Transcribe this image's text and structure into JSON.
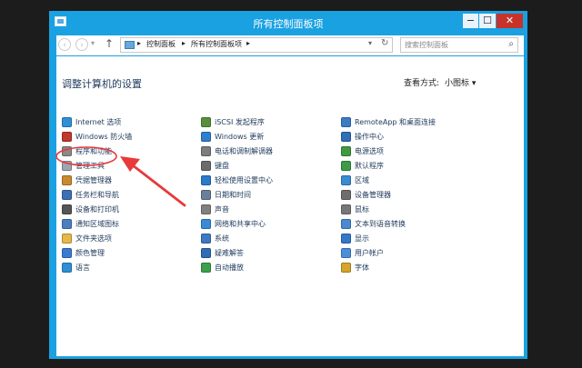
{
  "window": {
    "title": "所有控制面板项",
    "controls": {
      "minimize": "−",
      "maximize": "☐",
      "close": "✕"
    }
  },
  "navigation": {
    "back": "‹",
    "forward": "›",
    "history": "▾",
    "up": "↑",
    "breadcrumb": [
      "控制面板",
      "所有控制面板项"
    ],
    "separator": "▸",
    "refresh": "↻",
    "search_placeholder": "搜索控制面板"
  },
  "header": {
    "title": "调整计算机的设置",
    "view_label": "查看方式:",
    "view_value": "小图标 ▾"
  },
  "columns": [
    [
      {
        "label": "Internet 选项",
        "icon": "internet-options-icon",
        "color": "#2f8fd8"
      },
      {
        "label": "Windows 防火墙",
        "icon": "firewall-icon",
        "color": "#c0392b"
      },
      {
        "label": "程序和功能",
        "icon": "programs-icon",
        "color": "#8a8a8a"
      },
      {
        "label": "管理工具",
        "icon": "admin-tools-icon",
        "color": "#9aa6b2"
      },
      {
        "label": "凭据管理器",
        "icon": "credential-manager-icon",
        "color": "#c98a2d"
      },
      {
        "label": "任务栏和导航",
        "icon": "taskbar-icon",
        "color": "#3d6fb6"
      },
      {
        "label": "设备和打印机",
        "icon": "printer-icon",
        "color": "#555555"
      },
      {
        "label": "通知区域图标",
        "icon": "notification-icon",
        "color": "#4a7fc1"
      },
      {
        "label": "文件夹选项",
        "icon": "folder-icon",
        "color": "#e6b84a"
      },
      {
        "label": "颜色管理",
        "icon": "color-icon",
        "color": "#3b7ad0"
      },
      {
        "label": "语言",
        "icon": "language-icon",
        "color": "#2d8fd6"
      }
    ],
    [
      {
        "label": "iSCSI 发起程序",
        "icon": "iscsi-icon",
        "color": "#5a8f3a"
      },
      {
        "label": "Windows 更新",
        "icon": "windows-update-icon",
        "color": "#2f7ed0"
      },
      {
        "label": "电话和调制解调器",
        "icon": "phone-modem-icon",
        "color": "#7d7d7d"
      },
      {
        "label": "键盘",
        "icon": "keyboard-icon",
        "color": "#6b6b6b"
      },
      {
        "label": "轻松使用设置中心",
        "icon": "ease-of-access-icon",
        "color": "#2b79c9"
      },
      {
        "label": "日期和时间",
        "icon": "datetime-icon",
        "color": "#6a7f9a"
      },
      {
        "label": "声音",
        "icon": "sound-icon",
        "color": "#808080"
      },
      {
        "label": "网络和共享中心",
        "icon": "network-icon",
        "color": "#3a8ad6"
      },
      {
        "label": "系统",
        "icon": "system-icon",
        "color": "#3d78c2"
      },
      {
        "label": "疑难解答",
        "icon": "troubleshoot-icon",
        "color": "#2f6db5"
      },
      {
        "label": "自动播放",
        "icon": "autoplay-icon",
        "color": "#3ca14d"
      }
    ],
    [
      {
        "label": "RemoteApp 和桌面连接",
        "icon": "remoteapp-icon",
        "color": "#3c7cc4"
      },
      {
        "label": "操作中心",
        "icon": "action-center-icon",
        "color": "#2f6fb8"
      },
      {
        "label": "电源选项",
        "icon": "power-icon",
        "color": "#3f9a3f"
      },
      {
        "label": "默认程序",
        "icon": "default-programs-icon",
        "color": "#3d9b48"
      },
      {
        "label": "区域",
        "icon": "region-icon",
        "color": "#3a8bd2"
      },
      {
        "label": "设备管理器",
        "icon": "device-manager-icon",
        "color": "#6e6e6e"
      },
      {
        "label": "鼠标",
        "icon": "mouse-icon",
        "color": "#777777"
      },
      {
        "label": "文本到语音转换",
        "icon": "text-to-speech-icon",
        "color": "#4b8ad0"
      },
      {
        "label": "显示",
        "icon": "display-icon",
        "color": "#3479c8"
      },
      {
        "label": "用户帐户",
        "icon": "user-accounts-icon",
        "color": "#4a90d9"
      },
      {
        "label": "字体",
        "icon": "fonts-icon",
        "color": "#d4a52a"
      }
    ]
  ],
  "annotation": {
    "highlight_color": "#e8393b",
    "target": "管理工具"
  }
}
